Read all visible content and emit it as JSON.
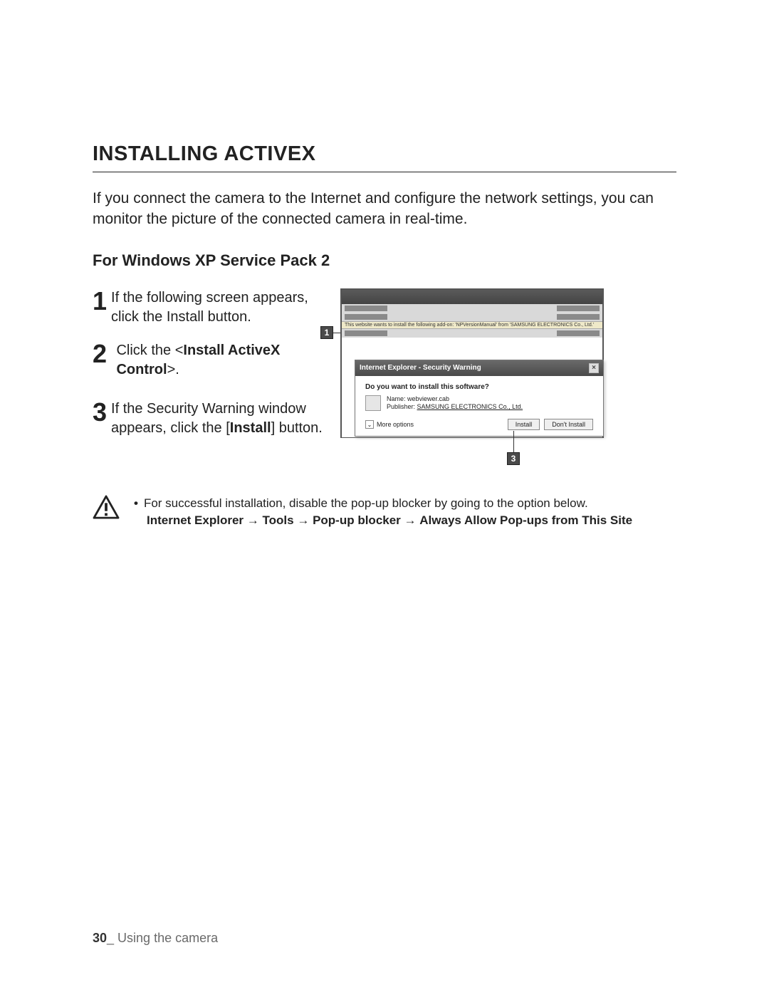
{
  "page": {
    "title": "INSTALLING ACTIVEX",
    "intro": "If you connect the camera to the Internet and configure the network settings, you can monitor the picture of the connected camera in real-time.",
    "subhead": "For Windows XP Service Pack 2"
  },
  "steps": {
    "s1_num": "1",
    "s1_text": "If the following screen appears, click the Install button.",
    "s2_num": "2",
    "s2_pre": "Click the <",
    "s2_bold": "Install ActiveX Control",
    "s2_post": ">.",
    "s3_num": "3",
    "s3_pre": "If the Security Warning window appears, click the [",
    "s3_bold": "Install",
    "s3_post": "] button."
  },
  "callouts": {
    "c1": "1",
    "c3": "3"
  },
  "screenshot": {
    "infobar_text": "This website wants to install the following add-on: 'NPVersionManual' from 'SAMSUNG ELECTRONICS Co., Ltd.'",
    "dialog_title": "Internet Explorer - Security Warning",
    "close_glyph": "×",
    "question": "Do you want to install this software?",
    "name_label": "Name:",
    "name_value": "webviewer.cab",
    "publisher_label": "Publisher:",
    "publisher_value": "SAMSUNG ELECTRONICS Co., Ltd.",
    "more_options": "More options",
    "chev": "⌄",
    "install_btn": "Install",
    "dont_install_btn": "Don't Install"
  },
  "note": {
    "bullet_text": "For successful installation, disable the pop-up blocker by going to the option below.",
    "path_p1": "Internet Explorer",
    "arrow": "→",
    "path_p2": "Tools",
    "path_p3": "Pop-up blocker",
    "path_p4": "Always Allow Pop-ups from This Site"
  },
  "footer": {
    "page_number": "30",
    "separator": "_ ",
    "section": "Using the camera"
  }
}
